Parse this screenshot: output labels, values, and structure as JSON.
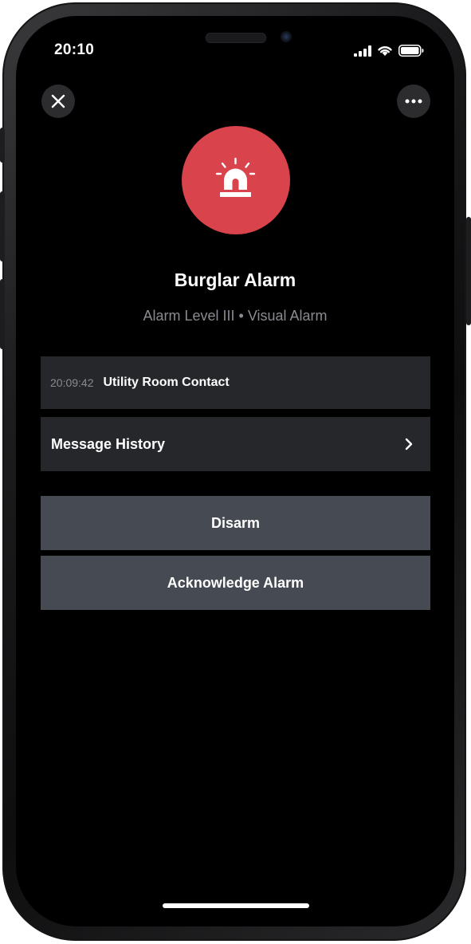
{
  "status_bar": {
    "time": "20:10"
  },
  "colors": {
    "alarm_red": "#d9434c",
    "row_bg": "#26272b",
    "button_bg": "#464a52",
    "subtitle_gray": "#8a8a92"
  },
  "icons": {
    "close": "close-icon",
    "more": "more-icon",
    "alarm": "siren-icon",
    "chevron": "chevron-right-icon",
    "signal": "cellular-signal-icon",
    "wifi": "wifi-icon",
    "battery": "battery-icon"
  },
  "alarm": {
    "title": "Burglar Alarm",
    "subtitle": "Alarm Level III • Visual Alarm"
  },
  "event": {
    "time": "20:09:42",
    "label": "Utility Room Contact"
  },
  "history": {
    "label": "Message History"
  },
  "actions": {
    "disarm_label": "Disarm",
    "acknowledge_label": "Acknowledge Alarm"
  }
}
